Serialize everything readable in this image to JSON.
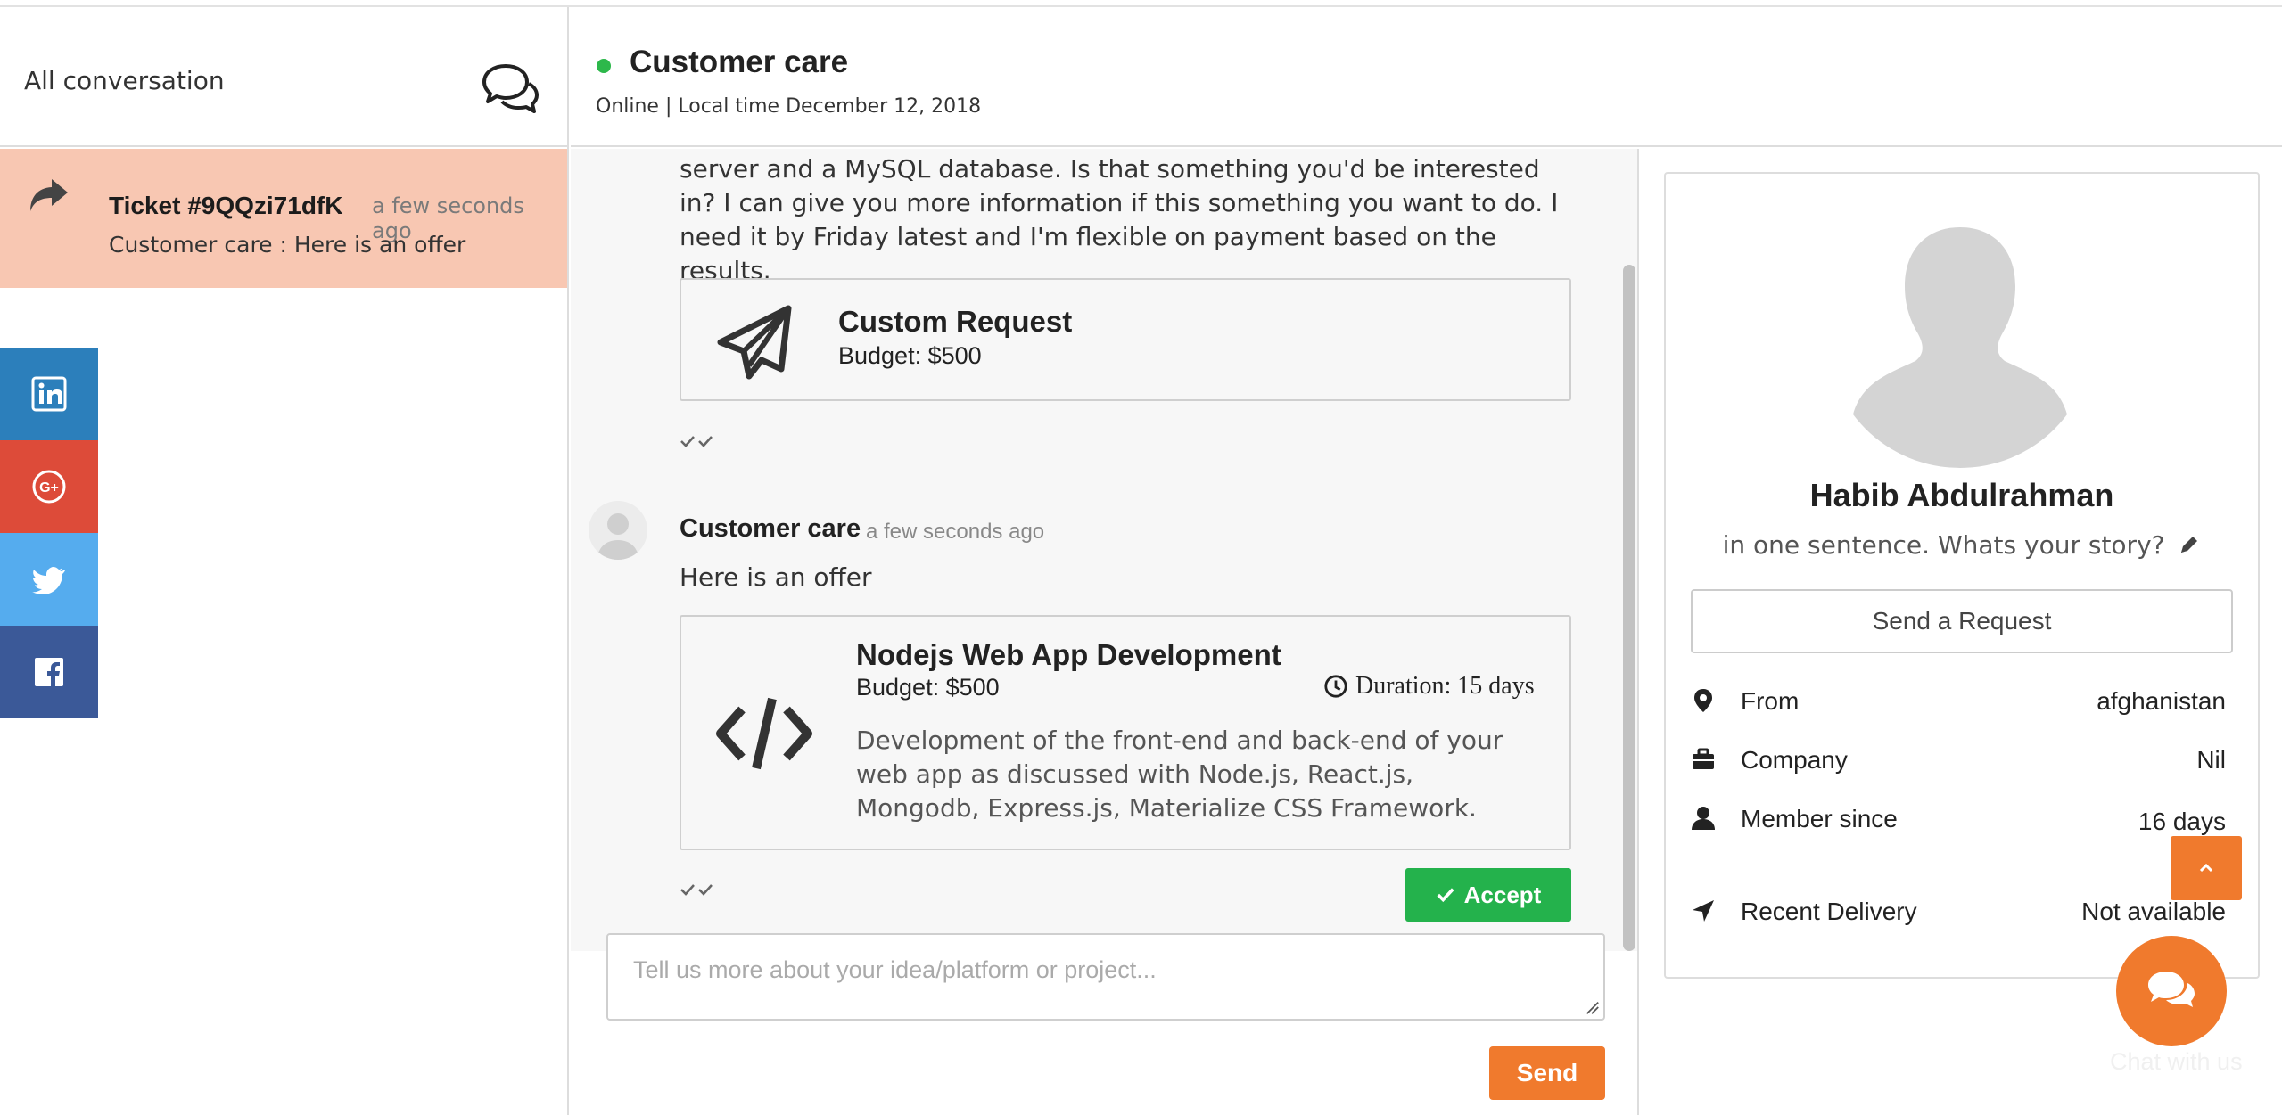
{
  "sidebar": {
    "title": "All conversation",
    "ticket": {
      "title": "Ticket #9QQzi71dfK",
      "time": "a few seconds ago",
      "preview": "Customer care : Here is an offer"
    },
    "social": [
      {
        "name": "linkedin",
        "color": "#2c7fbb"
      },
      {
        "name": "google-plus",
        "color": "#dd4b39"
      },
      {
        "name": "twitter",
        "color": "#55acee"
      },
      {
        "name": "facebook",
        "color": "#3b5998"
      }
    ]
  },
  "header": {
    "title": "Customer care",
    "status": "Online | Local time December 12, 2018"
  },
  "messages": {
    "first_text": "It's an ellster clone (https://www.ellster.com/) backed by a Node.js server and a MySQL database. Is that something you'd be interested in? I can give you more information if this something you want to do. I need it by Friday latest and I'm flexible on payment based on the results.",
    "custom_request": {
      "title": "Custom Request",
      "budget": "Budget: $500"
    },
    "second": {
      "sender": "Customer care",
      "time": "a few seconds ago",
      "text": "Here is an offer",
      "offer": {
        "title": "Nodejs Web App Development",
        "budget": "Budget: $500",
        "duration": "Duration: 15 days",
        "description": "Development of the front-end and back-end of your web app as discussed with Node.js, React.js, Mongodb, Express.js, Materialize CSS Framework."
      },
      "accept_label": "Accept"
    }
  },
  "composer": {
    "placeholder": "Tell us more about your idea/platform or project...",
    "send_label": "Send"
  },
  "profile": {
    "name": "Habib Abdulrahman",
    "story": "in one sentence. Whats your story?",
    "request_label": "Send a Request",
    "details": [
      {
        "label": "From",
        "value": "afghanistan"
      },
      {
        "label": "Company",
        "value": "Nil"
      },
      {
        "label": "Member since",
        "value": "16 days ago"
      },
      {
        "label": "Recent Delivery",
        "value": "Not available"
      }
    ]
  },
  "chat_widget": {
    "label": "Chat with us"
  },
  "colors": {
    "accent": "#f07a2d",
    "online": "#2db84b",
    "accept": "#24b24c",
    "ticket_bg": "#f8c7b2"
  }
}
